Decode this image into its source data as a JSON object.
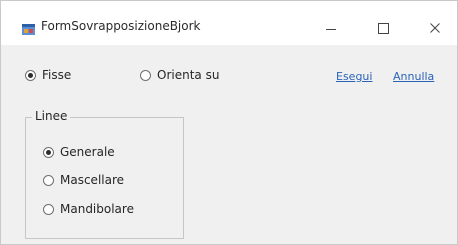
{
  "window": {
    "title": "FormSovrapposizioneBjork",
    "minimize_glyph": "—",
    "maximize_glyph": "☐",
    "close_glyph": "✕"
  },
  "mode": {
    "options": [
      {
        "label": "Fisse",
        "selected": true
      },
      {
        "label": "Orienta su",
        "selected": false
      }
    ]
  },
  "actions": {
    "esegui": "Esegui",
    "annulla": "Annulla"
  },
  "linee": {
    "title": "Linee",
    "options": [
      {
        "label": "Generale",
        "selected": true
      },
      {
        "label": "Mascellare",
        "selected": false
      },
      {
        "label": "Mandibolare",
        "selected": false
      }
    ]
  },
  "colors": {
    "link": "#2a63b8",
    "background": "#f0f0f0",
    "titlebar": "#ffffff"
  }
}
